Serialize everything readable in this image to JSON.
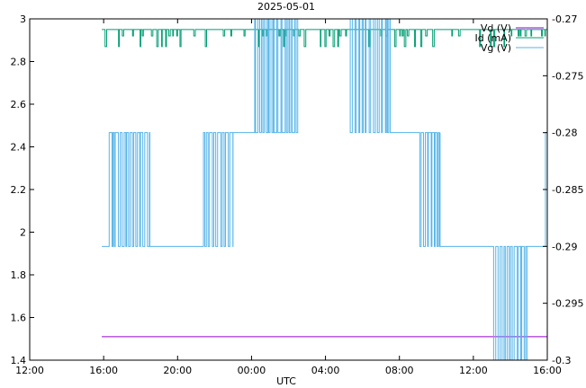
{
  "chart_data": {
    "type": "line",
    "title": "2025-05-01",
    "xlabel": "UTC",
    "ylabel": "",
    "y2label": "",
    "x_unit": "hours since 2025-04-30 12:00 UTC",
    "xlim": [
      0,
      28
    ],
    "ylim": [
      1.4,
      3.0
    ],
    "y2lim": [
      -0.3,
      -0.27
    ],
    "x_ticks": [
      {
        "value": 0,
        "label": "12:00"
      },
      {
        "value": 4,
        "label": "16:00"
      },
      {
        "value": 8,
        "label": "20:00"
      },
      {
        "value": 12,
        "label": "00:00"
      },
      {
        "value": 16,
        "label": "04:00"
      },
      {
        "value": 20,
        "label": "08:00"
      },
      {
        "value": 24,
        "label": "12:00"
      },
      {
        "value": 28,
        "label": "16:00"
      }
    ],
    "y_ticks": [
      {
        "value": 1.4,
        "label": "1.4"
      },
      {
        "value": 1.6,
        "label": "1.6"
      },
      {
        "value": 1.8,
        "label": "1.8"
      },
      {
        "value": 2.0,
        "label": "2"
      },
      {
        "value": 2.2,
        "label": "2.2"
      },
      {
        "value": 2.4,
        "label": "2.4"
      },
      {
        "value": 2.6,
        "label": "2.6"
      },
      {
        "value": 2.8,
        "label": "2.8"
      },
      {
        "value": 3.0,
        "label": "3"
      }
    ],
    "y2_ticks": [
      {
        "value": -0.3,
        "label": "-0.3"
      },
      {
        "value": -0.295,
        "label": "-0.295"
      },
      {
        "value": -0.29,
        "label": "-0.29"
      },
      {
        "value": -0.285,
        "label": "-0.285"
      },
      {
        "value": -0.28,
        "label": "-0.28"
      },
      {
        "value": -0.275,
        "label": "-0.275"
      },
      {
        "value": -0.27,
        "label": "-0.27"
      }
    ],
    "grid": false,
    "legend_position": "top-right",
    "series": [
      {
        "name": "Vd (V)",
        "axis": "y",
        "color": "#9400d3",
        "style": "flat",
        "x_start": 3.9,
        "x_end": 28.0,
        "y": 1.51
      },
      {
        "name": "Id (mA)",
        "axis": "y",
        "color": "#009e73",
        "style": "binary-noise",
        "x_start": 3.9,
        "x_end": 28.0,
        "levels": [
          2.95,
          2.92,
          2.87
        ],
        "base_level": 2.95
      },
      {
        "name": "Vg (V)",
        "axis": "y2",
        "color": "#56b4e9",
        "style": "steps",
        "segments": [
          {
            "x_start": 3.9,
            "x_end": 4.3,
            "y": -0.29
          },
          {
            "x_start": 4.3,
            "x_end": 6.5,
            "y": -0.28,
            "low": -0.29,
            "noisy": true
          },
          {
            "x_start": 6.5,
            "x_end": 9.4,
            "y": -0.29
          },
          {
            "x_start": 9.4,
            "x_end": 11.0,
            "y": -0.28,
            "low": -0.29,
            "noisy": true
          },
          {
            "x_start": 11.0,
            "x_end": 12.0,
            "y": -0.28
          },
          {
            "x_start": 12.0,
            "x_end": 14.5,
            "y": -0.28,
            "high": -0.27,
            "noisy": true
          },
          {
            "x_start": 14.5,
            "x_end": 17.2,
            "y": -0.27
          },
          {
            "x_start": 17.2,
            "x_end": 19.5,
            "y": -0.27,
            "low": -0.28,
            "noisy": true
          },
          {
            "x_start": 19.5,
            "x_end": 21.0,
            "y": -0.28
          },
          {
            "x_start": 21.0,
            "x_end": 22.2,
            "y": -0.28,
            "low": -0.29,
            "noisy": true
          },
          {
            "x_start": 22.2,
            "x_end": 25.0,
            "y": -0.29
          },
          {
            "x_start": 25.0,
            "x_end": 26.9,
            "y": -0.29,
            "low": -0.3,
            "noisy": true
          },
          {
            "x_start": 26.9,
            "x_end": 27.9,
            "y": -0.29
          },
          {
            "x_start": 27.9,
            "x_end": 28.0,
            "y": -0.28
          }
        ]
      }
    ]
  }
}
